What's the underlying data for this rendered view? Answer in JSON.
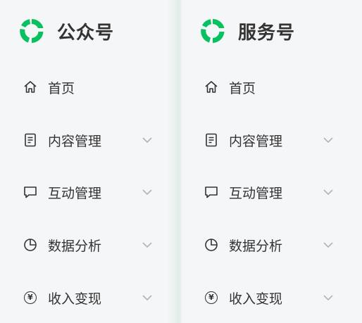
{
  "panels": [
    {
      "brand": {
        "name": "公众号",
        "logo": "wechat-logo-icon"
      },
      "nav": [
        {
          "label": "首页",
          "icon": "home-icon",
          "expandable": false
        },
        {
          "label": "内容管理",
          "icon": "document-icon",
          "expandable": true
        },
        {
          "label": "互动管理",
          "icon": "comment-icon",
          "expandable": true
        },
        {
          "label": "数据分析",
          "icon": "pie-chart-icon",
          "expandable": true
        },
        {
          "label": "收入变现",
          "icon": "yen-icon",
          "expandable": true
        }
      ]
    },
    {
      "brand": {
        "name": "服务号",
        "logo": "wechat-logo-icon"
      },
      "nav": [
        {
          "label": "首页",
          "icon": "home-icon",
          "expandable": false
        },
        {
          "label": "内容管理",
          "icon": "document-icon",
          "expandable": true
        },
        {
          "label": "互动管理",
          "icon": "comment-icon",
          "expandable": true
        },
        {
          "label": "数据分析",
          "icon": "pie-chart-icon",
          "expandable": true
        },
        {
          "label": "收入变现",
          "icon": "yen-icon",
          "expandable": true
        }
      ]
    }
  ],
  "colors": {
    "brand_green": "#07c160",
    "text": "#333333",
    "chevron": "#b3b3b3",
    "background": "#f5f6f8"
  }
}
